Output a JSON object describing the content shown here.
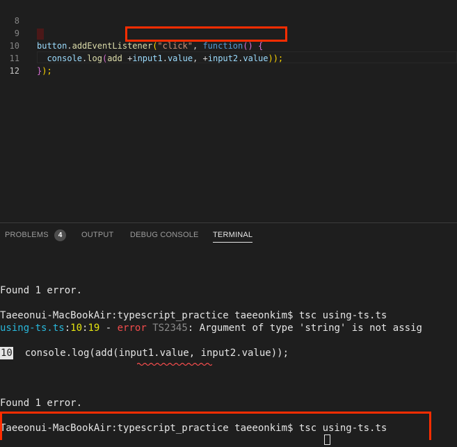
{
  "editor": {
    "line_numbers": [
      "8",
      "9",
      "10",
      "11",
      "12"
    ],
    "line9": {
      "obj": "button",
      "dot": ".",
      "method": "addEventListener",
      "open": "(",
      "str": "\"click\"",
      "comma": ", ",
      "kw": "function",
      "paren": "()",
      "space": " ",
      "brace": "{"
    },
    "line10": {
      "indent": "  ",
      "obj": "console",
      "dot": ".",
      "fn": "log",
      "open": "(",
      "fn2": "add",
      "space": " ",
      "plus1": "+",
      "var1": "input1",
      "dot1": ".",
      "prop1": "value",
      "comma": ", ",
      "plus2": "+",
      "var2": "input2",
      "dot2": ".",
      "prop2": "value",
      "close": "));"
    },
    "line11": {
      "brace": "}",
      "close": ");"
    }
  },
  "panel": {
    "tabs": [
      {
        "label": "PROBLEMS"
      },
      {
        "label": "OUTPUT"
      },
      {
        "label": "DEBUG CONSOLE"
      },
      {
        "label": "TERMINAL"
      }
    ],
    "problems_count": "4",
    "active_tab": "TERMINAL"
  },
  "terminal": {
    "found1": "Found 1 error.",
    "prompt1": "Taeeonui-MacBookAir:typescript_practice taeeonkim$ tsc using-ts.ts",
    "err_file": "using-ts.ts",
    "err_colon1": ":",
    "err_line": "10",
    "err_colon2": ":",
    "err_col": "19",
    "err_dash": " - ",
    "err_word": "error",
    "err_code": " TS2345",
    "err_msg": ": Argument of type 'string' is not assig",
    "snippet_ln": "10",
    "snippet_code": "  console.log(add(input1.value, input2.value));",
    "found2": "Found 1 error.",
    "prompt2": "Taeeonui-MacBookAir:typescript_practice taeeonkim$ tsc using-ts.ts"
  },
  "colors": {
    "accent_highlight": "#ff2d00",
    "error": "#f14c4c",
    "filename": "#29b8db",
    "position": "#e5e510"
  }
}
